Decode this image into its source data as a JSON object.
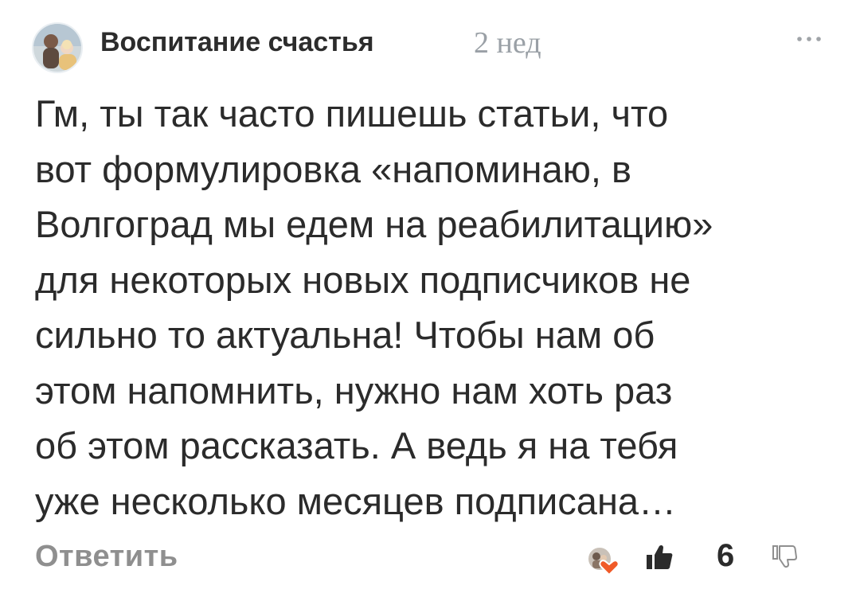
{
  "comment": {
    "author": "Воспитание счастья",
    "time": "2 нед",
    "text_lines": [
      "Гм, ты так часто пишешь статьи, что",
      "вот формулировка «напоминаю, в",
      "Волгоград мы едем на реабилитацию»",
      "для некоторых новых подписчиков не",
      "сильно то актуальна! Чтобы нам об",
      "этом напомнить, нужно нам хоть раз",
      "об этом рассказать. А ведь я на тебя",
      "уже несколько месяцев подписана…"
    ]
  },
  "footer": {
    "reply_label": "Ответить",
    "like_count": "6"
  },
  "icons": {
    "avatar": "user-avatar",
    "more": "more-dots-icon",
    "reactions": "heart-reaction-icon",
    "like": "thumbs-up-icon",
    "dislike": "thumbs-down-icon"
  },
  "colors": {
    "muted": "#9aa0a6",
    "reply": "#8f8f8f",
    "heart": "#f05a28"
  }
}
